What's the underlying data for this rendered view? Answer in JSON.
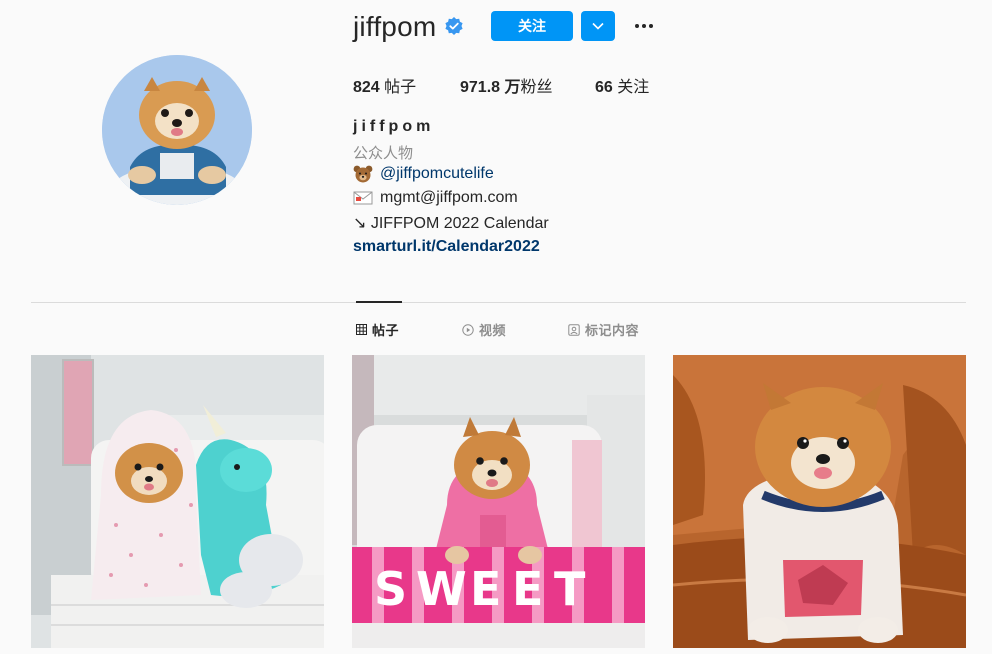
{
  "profile": {
    "username": "jiffpom",
    "follow_label": "关注",
    "stats": [
      {
        "value": "824",
        "label": " 帖子"
      },
      {
        "value": "971.8 万",
        "label": "粉丝"
      },
      {
        "value": "66",
        "label": " 关注"
      }
    ],
    "full_name": "jiffpom",
    "category": "公众人物",
    "bio": {
      "mention": "@jiffpomcutelife",
      "email": "mgmt@jiffpom.com",
      "calendar": "↘ JIFFPOM 2022 Calendar",
      "link": "smarturl.it/Calendar2022"
    }
  },
  "tabs": [
    {
      "label": "帖子",
      "icon": "grid-icon",
      "active": true
    },
    {
      "label": "视频",
      "icon": "video-icon",
      "active": false
    },
    {
      "label": "标记内容",
      "icon": "tagged-icon",
      "active": false
    }
  ],
  "posts": [
    {
      "description": "pomeranian-in-pink-hoodie-with-unicorn"
    },
    {
      "description": "pomeranian-pink-hoodie-sweet-pillow"
    },
    {
      "description": "pomeranian-on-leather-chair"
    }
  ],
  "colors": {
    "accent": "#0095f6",
    "link": "#00376b",
    "background": "#fafafa",
    "muted": "#8e8e8e"
  }
}
